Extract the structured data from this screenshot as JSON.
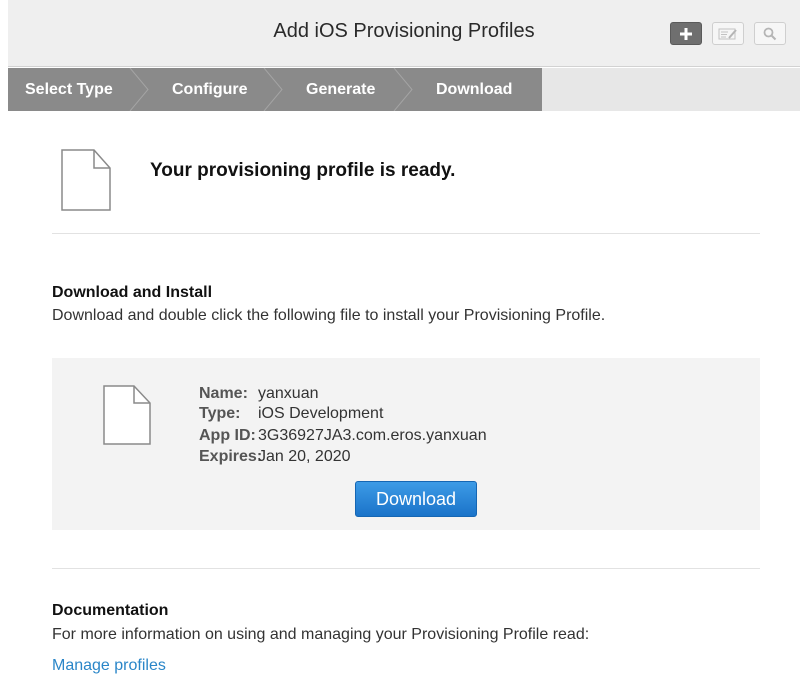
{
  "header": {
    "title": "Add iOS Provisioning Profiles",
    "buttons": [
      "plus-icon",
      "edit-icon",
      "search-icon"
    ]
  },
  "steps": [
    {
      "label": "Select Type"
    },
    {
      "label": "Configure"
    },
    {
      "label": "Generate"
    },
    {
      "label": "Download"
    }
  ],
  "ready": {
    "title": "Your provisioning profile is ready."
  },
  "download_section": {
    "title": "Download and Install",
    "text": "Download and double click the following file to install your Provisioning Profile."
  },
  "profile": {
    "name_label": "Name:",
    "name_value": "yanxuan",
    "type_label": "Type:",
    "type_value": "iOS Development",
    "appid_label": "App ID:",
    "appid_value": "3G36927JA3.com.eros.yanxuan",
    "expires_label": "Expires:",
    "expires_value": "Jan 20, 2020",
    "download_label": "Download"
  },
  "documentation": {
    "title": "Documentation",
    "text": "For more information on using and managing your Provisioning Profile read:",
    "link_label": "Manage profiles"
  },
  "colors": {
    "accent": "#1a73c9",
    "link": "#2a86c8",
    "steps_active": "#8a8a8a"
  }
}
